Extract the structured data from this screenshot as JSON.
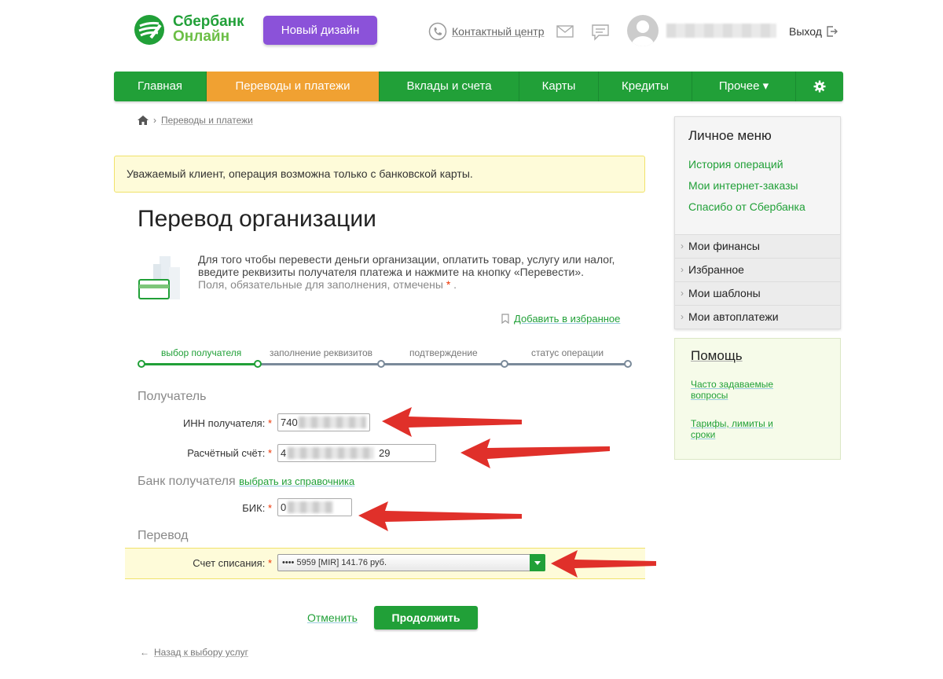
{
  "header": {
    "logo_line1": "Сбербанк",
    "logo_line2": "Онлайн",
    "new_design_button": "Новый дизайн",
    "contact_center": "Контактный центр",
    "logout": "Выход"
  },
  "nav": {
    "items": [
      {
        "label": "Главная",
        "active": false
      },
      {
        "label": "Переводы и платежи",
        "active": true
      },
      {
        "label": "Вклады и счета",
        "active": false
      },
      {
        "label": "Карты",
        "active": false
      },
      {
        "label": "Кредиты",
        "active": false
      },
      {
        "label": "Прочее ▾",
        "active": false
      }
    ]
  },
  "breadcrumb": {
    "current": "Переводы и платежи"
  },
  "notice": "Уважаемый клиент, операция возможна только с банковской карты.",
  "page_title": "Перевод организации",
  "intro": {
    "line1": "Для того чтобы перевести деньги организации, оплатить товар, услугу или налог,",
    "line2": "введите реквизиты получателя платежа и нажмите на кнопку «Перевести».",
    "line3": "Поля, обязательные для заполнения, отмечены",
    "required_mark": "*",
    "line3_end": "."
  },
  "add_favorite": "Добавить в избранное",
  "steps": [
    {
      "label": "выбор получателя",
      "active": true
    },
    {
      "label": "заполнение реквизитов",
      "active": false
    },
    {
      "label": "подтверждение",
      "active": false
    },
    {
      "label": "статус операции",
      "active": false
    }
  ],
  "sections": {
    "recipient": "Получатель",
    "bank": "Банк получателя",
    "bank_link": "выбрать из справочника",
    "transfer": "Перевод"
  },
  "fields": {
    "inn_label": "ИНН получателя:",
    "inn_value": "740",
    "account_label": "Расчётный счёт:",
    "account_value": "4",
    "account_value_end": "29",
    "bik_label": "БИК:",
    "bik_value": "0",
    "debit_label": "Счет списания:",
    "debit_value": "•••• 5959 [MIR] 141.76 руб.",
    "required_mark": "*"
  },
  "actions": {
    "cancel": "Отменить",
    "continue": "Продолжить",
    "back": "Назад к выбору услуг"
  },
  "sidebar": {
    "title": "Личное меню",
    "links": [
      "История операций",
      "Мои интернет-заказы",
      "Спасибо от Сбербанка"
    ],
    "items": [
      "Мои финансы",
      "Избранное",
      "Мои шаблоны",
      "Мои автоплатежи"
    ]
  },
  "help": {
    "title": "Помощь",
    "faq_line1": "Часто задаваемые",
    "faq_line2": "вопросы",
    "tariffs_line1": "Тарифы, лимиты и",
    "tariffs_line2": "сроки"
  },
  "colors": {
    "brand_green": "#21a038",
    "active_tab": "#f0a132",
    "new_design": "#8b52d9",
    "annotation_arrow": "#e0302a"
  }
}
